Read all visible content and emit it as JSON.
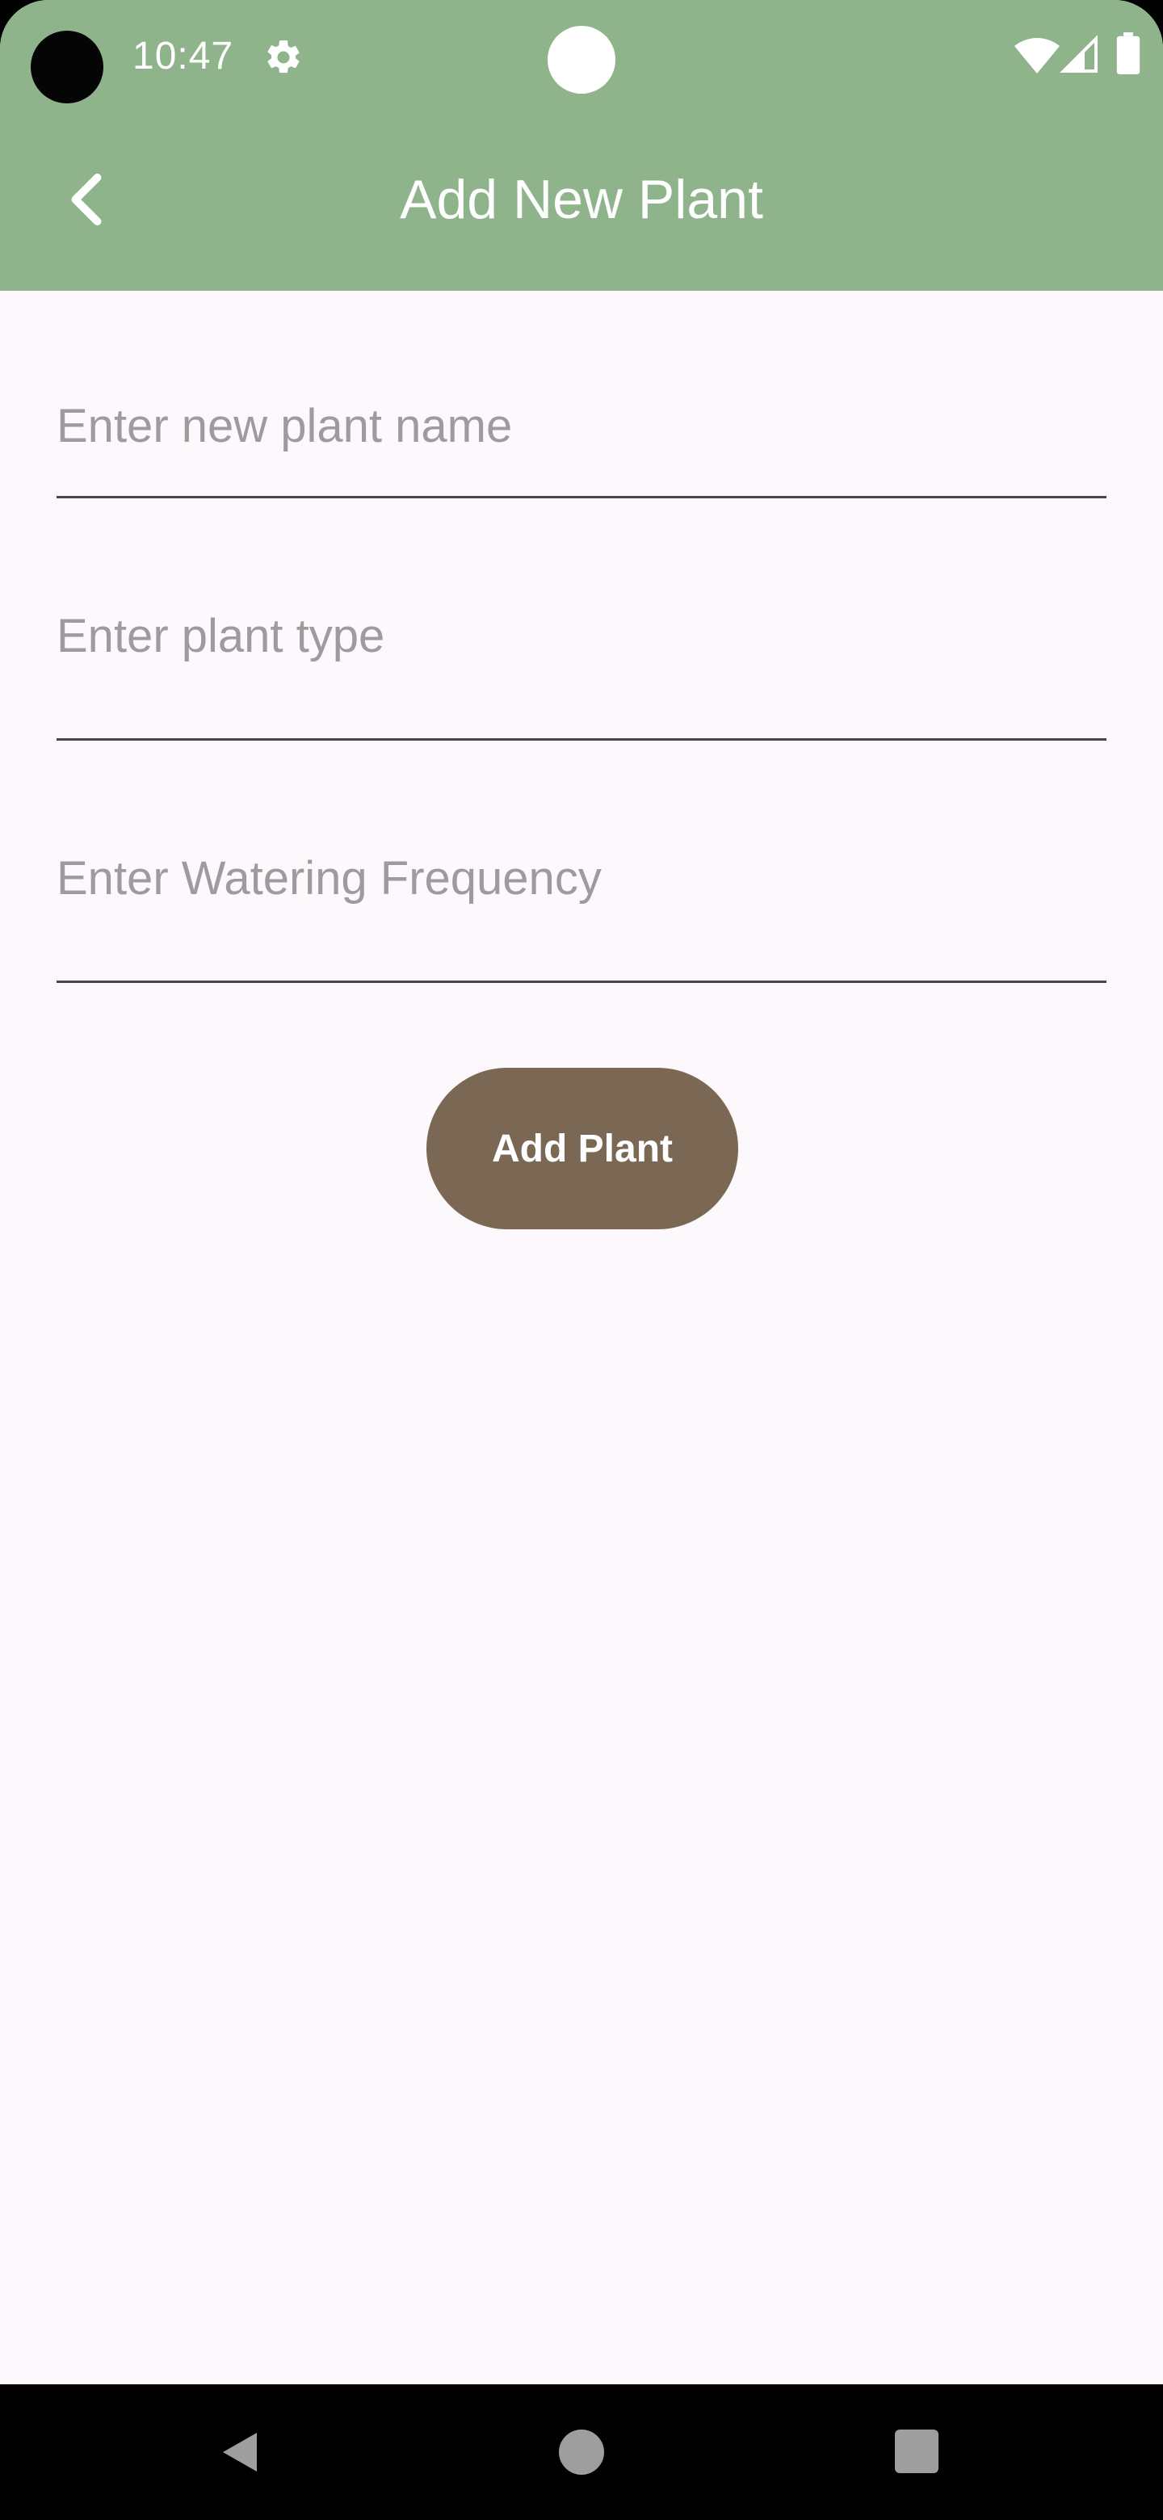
{
  "status_bar": {
    "time": "10:47",
    "icons": [
      "gear-icon",
      "wifi-icon",
      "signal-icon",
      "battery-icon"
    ]
  },
  "app_bar": {
    "title": "Add New Plant",
    "back_icon": "chevron-left-icon"
  },
  "form": {
    "plant_name": {
      "placeholder": "Enter new plant name",
      "value": ""
    },
    "plant_type": {
      "placeholder": "Enter plant type",
      "value": ""
    },
    "watering_frequency": {
      "placeholder": "Enter Watering Frequency",
      "value": ""
    },
    "submit_label": "Add Plant"
  },
  "nav_bar": {
    "icons": [
      "nav-back-icon",
      "nav-home-icon",
      "nav-recents-icon"
    ]
  },
  "colors": {
    "app_bar": "#8FB48C",
    "background": "#FDF8FC",
    "button": "#7B6854",
    "placeholder": "#9E9A9D",
    "underline": "#4A4548"
  }
}
